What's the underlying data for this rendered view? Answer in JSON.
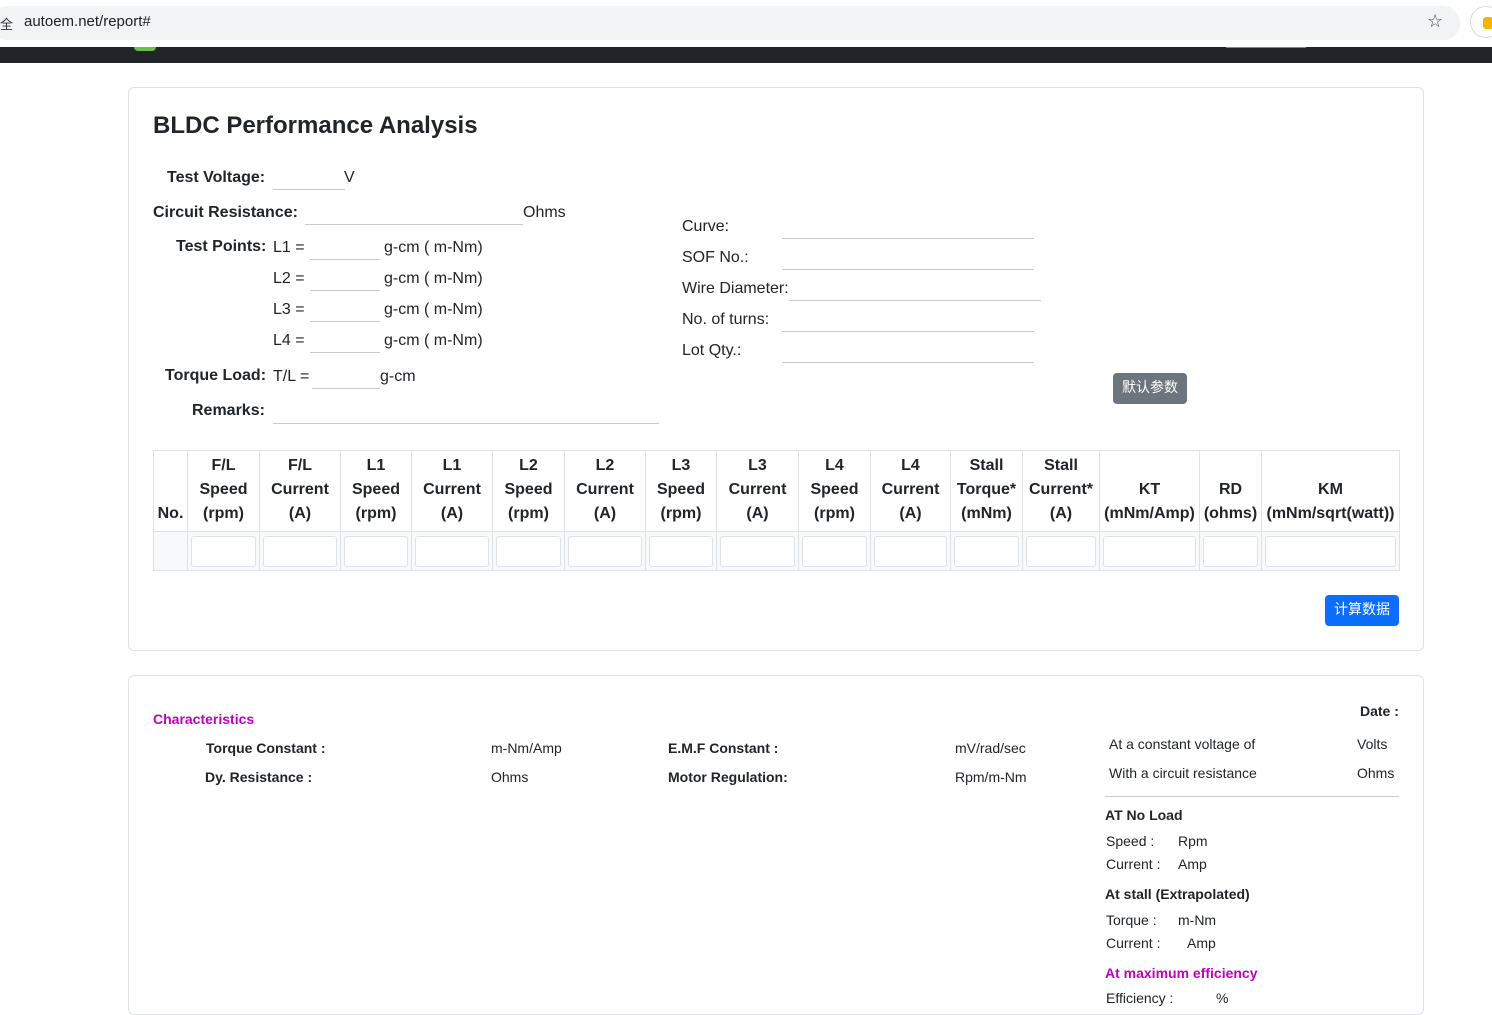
{
  "browser": {
    "lock_glyph": "全",
    "url": "autoem.net/report#"
  },
  "form": {
    "title": "BLDC Performance Analysis",
    "test_voltage_label": "Test Voltage:",
    "test_voltage_unit": "V",
    "circuit_resistance_label": "Circuit Resistance:",
    "circuit_resistance_unit": "Ohms",
    "test_points_label": "Test Points:",
    "test_points": [
      {
        "label": "L1 =",
        "unit": "g-cm ( m-Nm)"
      },
      {
        "label": "L2 =",
        "unit": "g-cm ( m-Nm)"
      },
      {
        "label": "L3 =",
        "unit": "g-cm ( m-Nm)"
      },
      {
        "label": "L4 =",
        "unit": "g-cm ( m-Nm)"
      }
    ],
    "torque_load_label": "Torque Load:",
    "torque_load_prefix": "T/L =",
    "torque_load_unit": "g-cm",
    "remarks_label": "Remarks:",
    "curve_label": "Curve:",
    "sof_label": "SOF No.:",
    "wire_label": "Wire Diameter:",
    "turns_label": "No. of turns:",
    "lot_label": "Lot Qty.:",
    "default_button": "默认参数",
    "calc_button": "计算数据"
  },
  "table": {
    "headers": [
      {
        "l1": "",
        "l2": "",
        "l3": "No."
      },
      {
        "l1": "F/L",
        "l2": "Speed",
        "l3": "(rpm)"
      },
      {
        "l1": "F/L",
        "l2": "Current",
        "l3": "(A)"
      },
      {
        "l1": "L1",
        "l2": "Speed",
        "l3": "(rpm)"
      },
      {
        "l1": "L1",
        "l2": "Current",
        "l3": "(A)"
      },
      {
        "l1": "L2",
        "l2": "Speed",
        "l3": "(rpm)"
      },
      {
        "l1": "L2",
        "l2": "Current",
        "l3": "(A)"
      },
      {
        "l1": "L3",
        "l2": "Speed",
        "l3": "(rpm)"
      },
      {
        "l1": "L3",
        "l2": "Current",
        "l3": "(A)"
      },
      {
        "l1": "L4",
        "l2": "Speed",
        "l3": "(rpm)"
      },
      {
        "l1": "L4",
        "l2": "Current",
        "l3": "(A)"
      },
      {
        "l1": "Stall",
        "l2": "Torque*",
        "l3": "(mNm)"
      },
      {
        "l1": "Stall",
        "l2": "Current*",
        "l3": "(A)"
      },
      {
        "l1": "",
        "l2": "KT",
        "l3": "(mNm/Amp)"
      },
      {
        "l1": "",
        "l2": "RD",
        "l3": "(ohms)"
      },
      {
        "l1": "",
        "l2": "KM",
        "l3": "(mNm/sqrt(watt))"
      }
    ]
  },
  "report": {
    "characteristics_title": "Characteristics",
    "date_label": "Date :",
    "torque_constant_label": "Torque Constant :",
    "torque_constant_unit": "m-Nm/Amp",
    "emf_label": "E.M.F Constant :",
    "emf_unit": "mV/rad/sec",
    "dy_res_label": "Dy. Resistance :",
    "dy_res_unit": "Ohms",
    "motor_reg_label": "Motor Regulation:",
    "motor_reg_unit": "Rpm/m-Nm",
    "const_voltage_label": "At a constant voltage of",
    "const_voltage_unit": "Volts",
    "circuit_res_label": "With a circuit resistance",
    "circuit_res_unit": "Ohms",
    "no_load_title": "AT No Load",
    "no_load_speed_label": "Speed :",
    "no_load_speed_unit": "Rpm",
    "no_load_current_label": "Current :",
    "no_load_current_unit": "Amp",
    "stall_title": "At stall (Extrapolated)",
    "stall_torque_label": "Torque :",
    "stall_torque_unit": "m-Nm",
    "stall_current_label": "Current :",
    "stall_current_unit": "Amp",
    "max_eff_title": "At maximum efficiency",
    "efficiency_label": "Efficiency :",
    "efficiency_unit": "%"
  }
}
